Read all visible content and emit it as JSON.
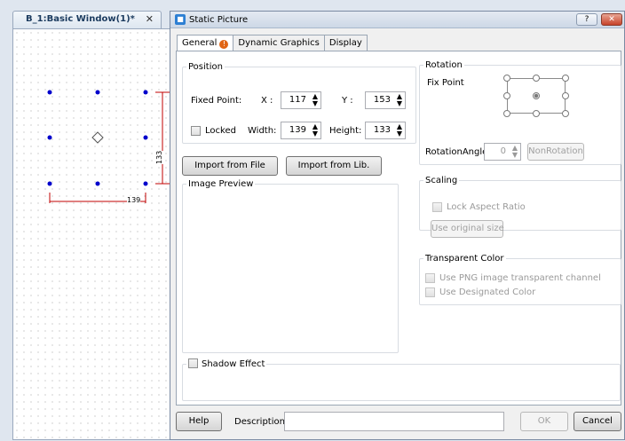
{
  "editor": {
    "tab_title": "B_1:Basic Window(1)*",
    "close_glyph": "✕",
    "dim_width": "139",
    "dim_height": "133"
  },
  "dialog": {
    "title": "Static Picture",
    "help_glyph": "?",
    "close_glyph": "✕",
    "tabs": [
      {
        "label": "General"
      },
      {
        "label": "Dynamic Graphics"
      },
      {
        "label": "Display"
      }
    ],
    "position": {
      "legend": "Position",
      "fixed_point_label": "Fixed Point:",
      "x_label": "X :",
      "x_value": "117",
      "y_label": "Y :",
      "y_value": "153",
      "locked_label": "Locked",
      "width_label": "Width:",
      "width_value": "139",
      "height_label": "Height:",
      "height_value": "133"
    },
    "import_file_label": "Import from File",
    "import_lib_label": "Import from Lib.",
    "image_preview_legend": "Image Preview",
    "shadow_effect_label": "Shadow Effect",
    "rotation": {
      "legend": "Rotation",
      "fix_point_label": "Fix Point",
      "angle_label": "RotationAngle",
      "angle_value": "0",
      "nonrotation_label": "NonRotation"
    },
    "scaling": {
      "legend": "Scaling",
      "lock_aspect_label": "Lock Aspect Ratio",
      "use_original_label": "Use original size"
    },
    "transparent": {
      "legend": "Transparent Color",
      "png_channel_label": "Use PNG image transparent channel",
      "designated_label": "Use Designated Color"
    },
    "footer": {
      "help_label": "Help",
      "description_label": "Description:",
      "description_value": "",
      "ok_label": "OK",
      "cancel_label": "Cancel"
    }
  },
  "colors": {
    "handle": "#0000cc",
    "dimension_line": "#c00000",
    "warning": "#e06414"
  }
}
